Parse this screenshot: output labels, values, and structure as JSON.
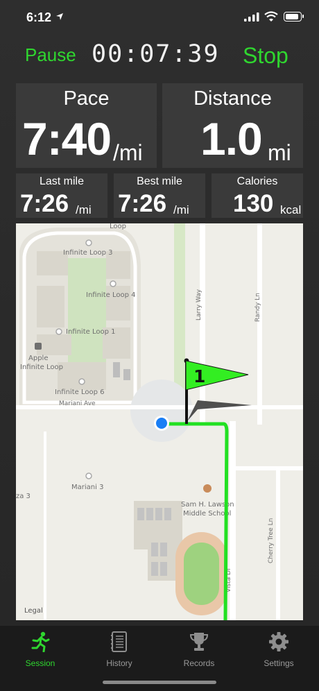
{
  "status": {
    "time": "6:12"
  },
  "controls": {
    "pause_label": "Pause",
    "timer": "00:07:39",
    "stop_label": "Stop"
  },
  "stats": {
    "pace": {
      "label": "Pace",
      "value": "7:40",
      "unit": "/mi"
    },
    "distance": {
      "label": "Distance",
      "value": "1.0",
      "unit": "mi"
    },
    "last_mile": {
      "label": "Last mile",
      "value": "7:26",
      "unit": "/mi"
    },
    "best_mile": {
      "label": "Best mile",
      "value": "7:26",
      "unit": "/mi"
    },
    "calories": {
      "label": "Calories",
      "value": "130",
      "unit": "kcal"
    }
  },
  "map": {
    "labels": {
      "loop_road": "Loop",
      "il3": "Infinite Loop 3",
      "il4": "Infinite Loop 4",
      "il1": "Infinite Loop 1",
      "apple_l1": "Apple",
      "apple_l2": "Infinite Loop",
      "il6": "Infinite Loop 6",
      "mariani_ave": "Mariani Ave",
      "mariani3": "Mariani 3",
      "za3": "za 3",
      "larry_way": "Larry Way",
      "randy_ln": "Randy Ln",
      "school_l1": "Sam H. Lawson",
      "school_l2": "Middle School",
      "vista_dr": "Vista Dr",
      "cherry_tree": "Cherry Tree Ln",
      "legal": "Legal"
    },
    "flag_number": "1",
    "route_color": "#22e022",
    "location_color": "#1a7ef5"
  },
  "tabs": [
    {
      "label": "Session",
      "icon": "runner-icon",
      "active": true
    },
    {
      "label": "History",
      "icon": "notebook-icon",
      "active": false
    },
    {
      "label": "Records",
      "icon": "trophy-icon",
      "active": false
    },
    {
      "label": "Settings",
      "icon": "gear-icon",
      "active": false
    }
  ],
  "colors": {
    "accent": "#2fd62f",
    "box_bg": "#3a3a3a",
    "tabbar_bg": "#1b1b1b"
  }
}
